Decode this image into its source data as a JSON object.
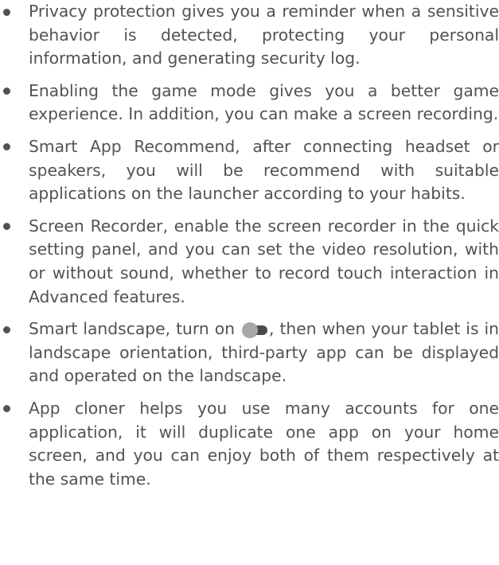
{
  "items": [
    {
      "text": "Privacy protection gives you a reminder when a sensitive behavior is detected, protecting your personal information, and generating security log."
    },
    {
      "text": "Enabling the game mode gives you a better game experience. In addition, you can make a screen recording."
    },
    {
      "text": "Smart App Recommend, after connecting headset or speakers, you will be recommend with suitable applications on the launcher according to your habits."
    },
    {
      "text": "Screen Recorder, enable the screen recorder in the quick setting panel, and you can set the video resolution, with or without sound, whether to record touch interaction in Advanced features."
    },
    {
      "text_before": "Smart landscape, turn on",
      "toggle_icon": "toggle-switch-icon",
      "text_after": ", then when your tablet is in landscape orientation, third-party app can be displayed and operated on the landscape."
    },
    {
      "text": "App cloner helps you use many accounts for one application, it will duplicate one app on your home screen, and you can enjoy both of them respectively at the same time."
    }
  ],
  "colors": {
    "text": "#505355",
    "toggle_track": "#4a4a4a",
    "toggle_knob": "#a8a8a8"
  }
}
